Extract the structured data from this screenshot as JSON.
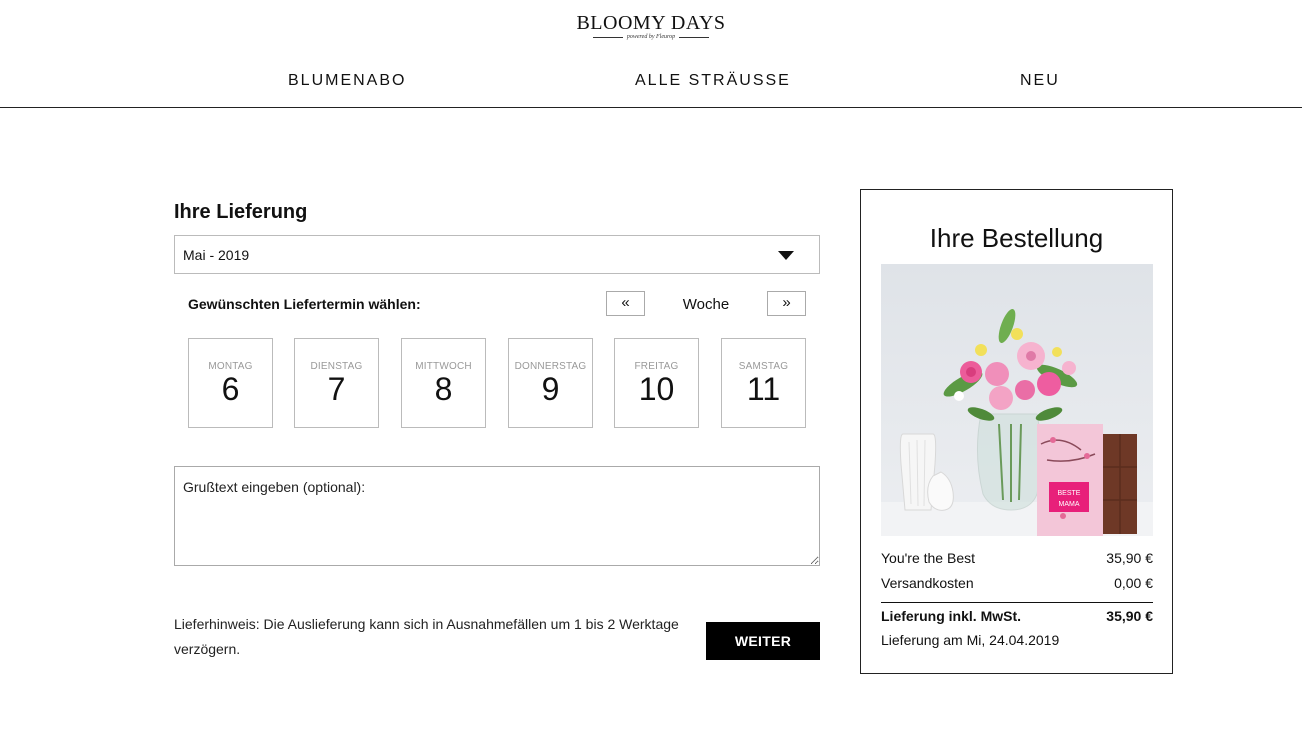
{
  "header": {
    "logo_main": "BLOOMY DAYS",
    "logo_sub": "powered by Fleurop",
    "nav": [
      "BLUMENABO",
      "ALLE STRÄUSSE",
      "NEU"
    ]
  },
  "delivery": {
    "title": "Ihre Lieferung",
    "month_selected": "Mai - 2019",
    "date_prompt": "Gewünschten Liefertermin wählen:",
    "week_prev": "«",
    "week_label": "Woche",
    "week_next": "»",
    "days": [
      {
        "name": "MONTAG",
        "num": "6"
      },
      {
        "name": "DIENSTAG",
        "num": "7"
      },
      {
        "name": "MITTWOCH",
        "num": "8"
      },
      {
        "name": "DONNERSTAG",
        "num": "9"
      },
      {
        "name": "FREITAG",
        "num": "10"
      },
      {
        "name": "SAMSTAG",
        "num": "11"
      }
    ],
    "greeting_placeholder": "Grußtext eingeben (optional):",
    "note": "Lieferhinweis: Die Auslieferung kann sich in Ausnahmefällen um 1 bis 2 Werktage verzögern.",
    "next_button": "WEITER"
  },
  "order": {
    "title": "Ihre Bestellung",
    "product_name": "You're the Best",
    "product_price": "35,90 €",
    "shipping_label": "Versandkosten",
    "shipping_price": "0,00 €",
    "total_label": "Lieferung inkl. MwSt.",
    "total_price": "35,90 €",
    "delivery_date": "Lieferung am Mi, 24.04.2019",
    "chocolate_text": "BESTE MAMA"
  },
  "colors": {
    "accent": "#000000",
    "border": "#bbbbbb",
    "muted": "#999999"
  }
}
